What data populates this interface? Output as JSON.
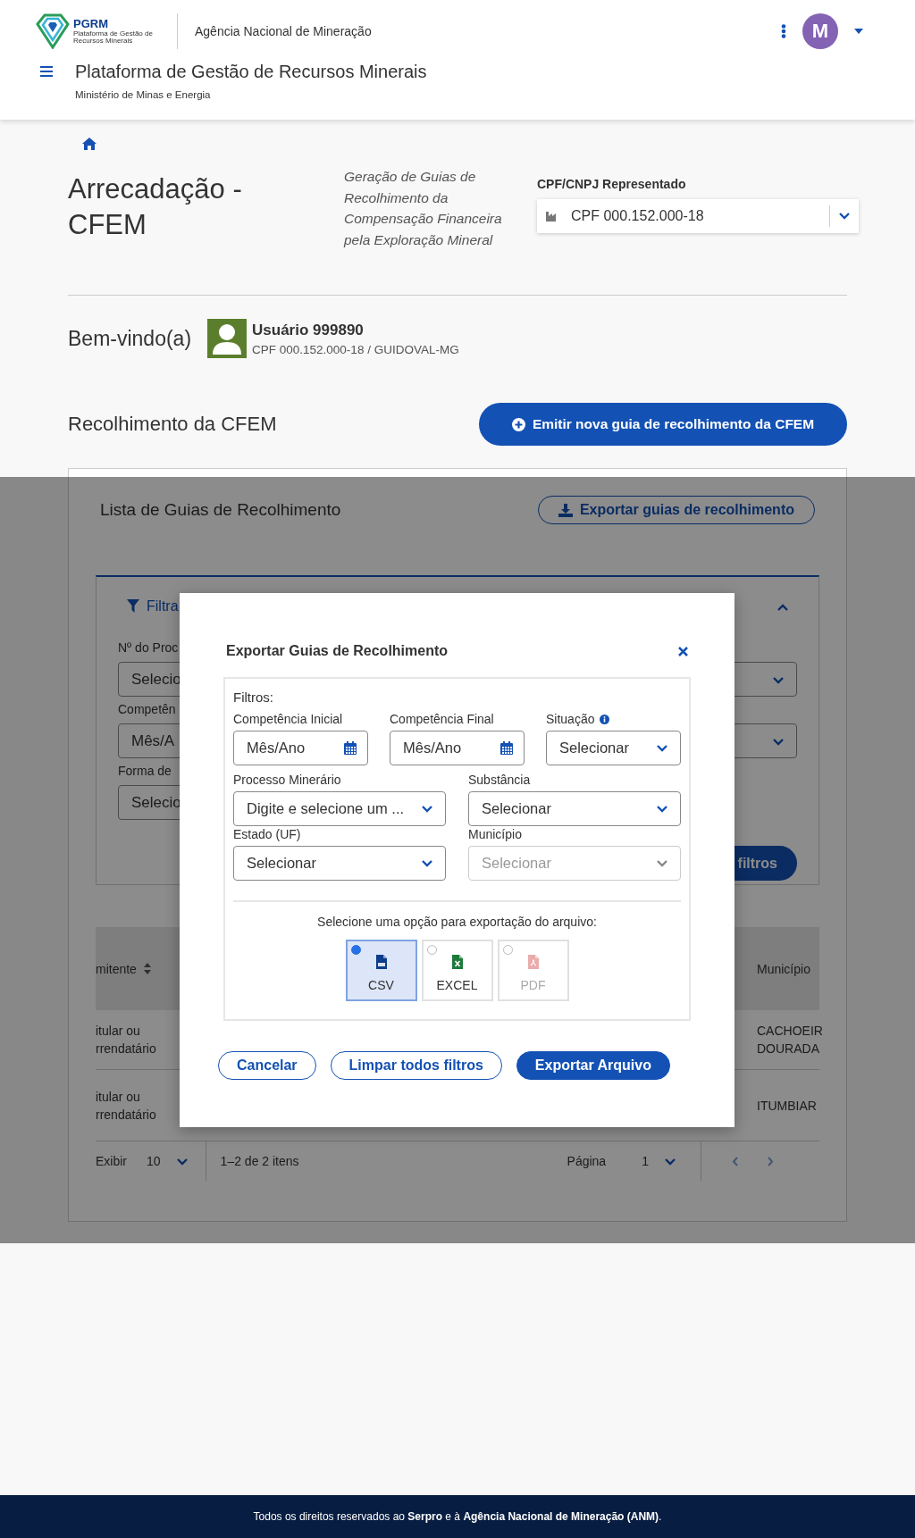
{
  "header": {
    "logo": {
      "acronym": "PGRM",
      "name": "Plataforma de Gestão de Recursos Minerais"
    },
    "agency": "Agência Nacional de Mineração",
    "avatar_initial": "M",
    "title": "Plataforma de Gestão de Recursos Minerais",
    "subtitle": "Ministério de Minas e Energia"
  },
  "page": {
    "title": "Arrecadação - CFEM",
    "description": "Geração de Guias de Recolhimento da Compensação Financeira pela Exploração Mineral",
    "represented": {
      "label": "CPF/CNPJ Representado",
      "value": "CPF 000.152.000-18"
    }
  },
  "welcome": {
    "greeting": "Bem-vindo(a)",
    "user_name": "Usuário 999890",
    "user_detail": "CPF 000.152.000-18 / GUIDOVAL-MG"
  },
  "section": {
    "title": "Recolhimento da CFEM",
    "primary_button": "Emitir nova guia de recolhimento da CFEM"
  },
  "list": {
    "title": "Lista de Guias de Recolhimento",
    "export_button": "Exportar guias de recolhimento",
    "filter_panel": {
      "title": "Filtra",
      "expanded": true,
      "fields": [
        {
          "label": "Nº do Proc",
          "value": "Selecio"
        },
        {
          "label": "Competên",
          "value": "Mês/A"
        },
        {
          "label": "Forma de",
          "value": "Selecio"
        }
      ],
      "apply_button": "filtros"
    },
    "table": {
      "columns": [
        "mitente",
        "Município"
      ],
      "rows": [
        [
          "itular ou rrendatário",
          "CACHOEIR DOURADA"
        ],
        [
          "itular ou rrendatário",
          "ITUMBIAR"
        ]
      ]
    },
    "pagination": {
      "show_label": "Exibir",
      "page_size": "10",
      "range": "1–2 de 2 itens",
      "page_label": "Página",
      "page": "1"
    }
  },
  "modal": {
    "title": "Exportar Guias de Recolhimento",
    "filters_label": "Filtros:",
    "fields": [
      {
        "kind": "date",
        "label": "Competência Inicial",
        "placeholder": "Mês/Ano",
        "info": false,
        "disabled": false
      },
      {
        "kind": "date",
        "label": "Competência Final",
        "placeholder": "Mês/Ano",
        "info": false,
        "disabled": false
      },
      {
        "kind": "select",
        "label": "Situação",
        "value": "Selecionar",
        "info": true,
        "disabled": false
      },
      {
        "kind": "select",
        "label": "Processo Minerário",
        "value": "Digite e selecione um ...",
        "info": false,
        "disabled": false
      },
      {
        "kind": "select",
        "label": "Substância",
        "value": "Selecionar",
        "info": false,
        "disabled": false
      },
      {
        "kind": "select",
        "label": "Estado (UF)",
        "value": "Selecionar",
        "info": false,
        "disabled": false
      },
      {
        "kind": "select",
        "label": "Município",
        "placeholder": "Selecionar",
        "info": false,
        "disabled": true
      }
    ],
    "export_prompt": "Selecione uma opção para exportação do arquivo:",
    "options": [
      {
        "kind": "csv",
        "label": "CSV",
        "selected": true,
        "disabled": false
      },
      {
        "kind": "excel",
        "label": "EXCEL",
        "selected": false,
        "disabled": false
      },
      {
        "kind": "pdf",
        "label": "PDF",
        "selected": false,
        "disabled": true
      }
    ],
    "buttons": [
      {
        "kind": "outline",
        "label": "Cancelar"
      },
      {
        "kind": "outline",
        "label": "Limpar todos filtros"
      },
      {
        "kind": "primary",
        "label": "Exportar Arquivo"
      }
    ]
  },
  "footer": "Todos os direitos reservados ao **Serpro** e à **Agência Nacional de Mineração (ANM)**."
}
